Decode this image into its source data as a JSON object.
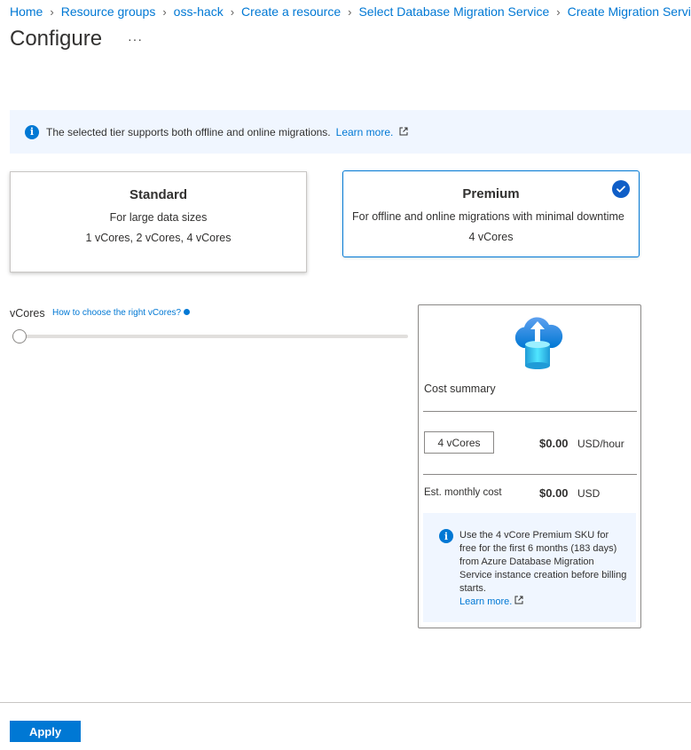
{
  "breadcrumb": [
    {
      "label": "Home"
    },
    {
      "label": "Resource groups"
    },
    {
      "label": "oss-hack"
    },
    {
      "label": "Create a resource"
    },
    {
      "label": "Select Database Migration Service"
    },
    {
      "label": "Create Migration Service"
    }
  ],
  "header": {
    "title": "Configure",
    "more": "···"
  },
  "infobar": {
    "text": "The selected tier supports both offline and online migrations.",
    "link": "Learn more."
  },
  "tiers": {
    "standard": {
      "name": "Standard",
      "description": "For large data sizes",
      "cores": "1 vCores, 2 vCores, 4 vCores",
      "selected": false
    },
    "premium": {
      "name": "Premium",
      "description": "For offline and online migrations with minimal downtime",
      "cores": "4 vCores",
      "selected": true
    }
  },
  "vcores": {
    "label": "vCores",
    "help_link": "How to choose the right vCores?",
    "slider_value_fraction": 0
  },
  "cost_summary": {
    "title": "Cost summary",
    "vcore_value": "4 vCores",
    "hourly_price": "$0.00",
    "hourly_unit": "USD/hour",
    "monthly_label": "Est. monthly cost",
    "monthly_price": "$0.00",
    "monthly_unit": "USD",
    "info_text": "Use the 4 vCore Premium SKU for free for the first 6 months (183 days) from Azure Database Migration Service instance creation before billing starts.",
    "info_link": "Learn more."
  },
  "footer": {
    "apply_label": "Apply"
  },
  "colors": {
    "accent": "#0078d4",
    "info_bg": "#f0f6ff",
    "check": "#0f5ec7"
  }
}
